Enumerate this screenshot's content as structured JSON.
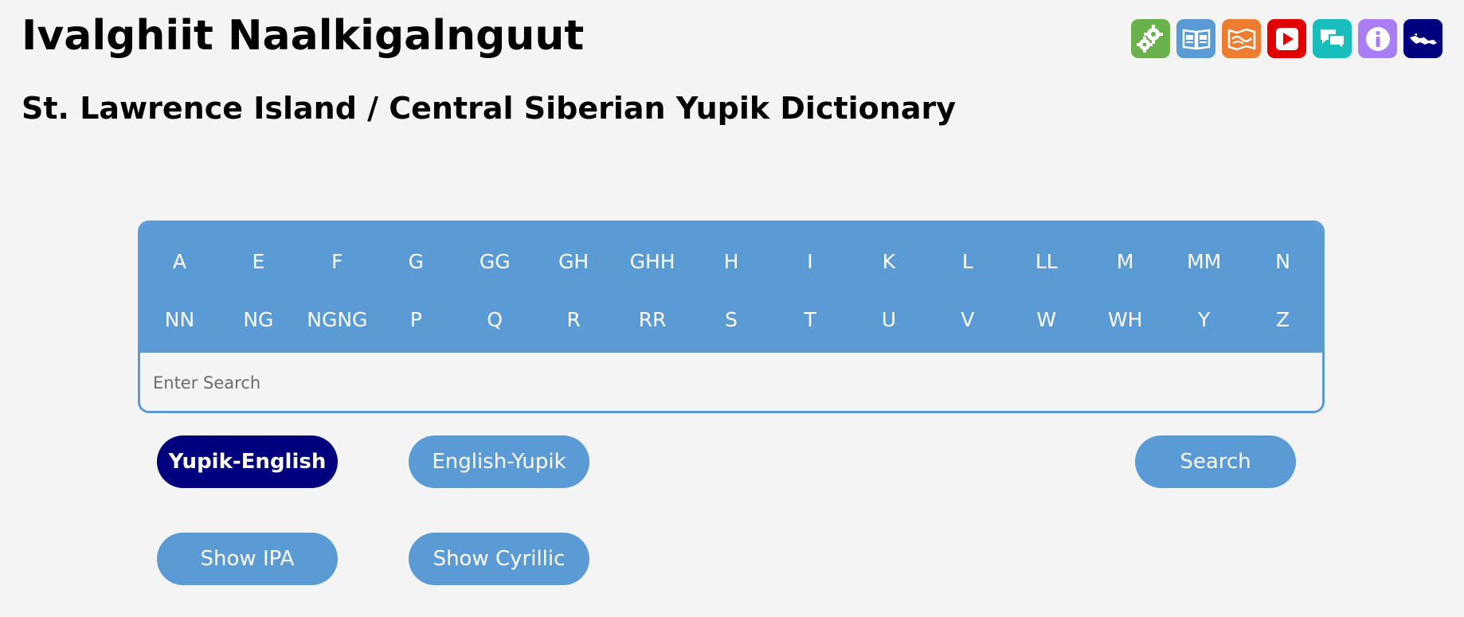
{
  "header": {
    "title": "Ivalghiit Naalkigalnguut",
    "subtitle": "St. Lawrence Island / Central Siberian Yupik Dictionary"
  },
  "icons": [
    {
      "name": "settings-gears-icon",
      "color": "#6ab04c"
    },
    {
      "name": "open-book-icon",
      "color": "#5b9bd5"
    },
    {
      "name": "map-icon",
      "color": "#ed7d31"
    },
    {
      "name": "video-play-icon",
      "color": "#e00000"
    },
    {
      "name": "chat-bubbles-icon",
      "color": "#17bebb"
    },
    {
      "name": "info-icon",
      "color": "#a97ef5"
    },
    {
      "name": "island-icon",
      "color": "#00007f"
    }
  ],
  "keyboard": {
    "row1": [
      "A",
      "E",
      "F",
      "G",
      "GG",
      "GH",
      "GHH",
      "H",
      "I",
      "K",
      "L",
      "LL",
      "M",
      "MM",
      "N"
    ],
    "row2": [
      "NN",
      "NG",
      "NGNG",
      "P",
      "Q",
      "R",
      "RR",
      "S",
      "T",
      "U",
      "V",
      "W",
      "WH",
      "Y",
      "Z"
    ],
    "accent_color": "#5b9bd5"
  },
  "search": {
    "placeholder": "Enter Search",
    "value": ""
  },
  "buttons": {
    "yupik_english": "Yupik-English",
    "english_yupik": "English-Yupik",
    "search": "Search",
    "show_ipa": "Show IPA",
    "show_cyrillic": "Show Cyrillic"
  },
  "colors": {
    "active_button": "#00007f",
    "button": "#5b9bd5",
    "background": "#f4f4f4"
  }
}
